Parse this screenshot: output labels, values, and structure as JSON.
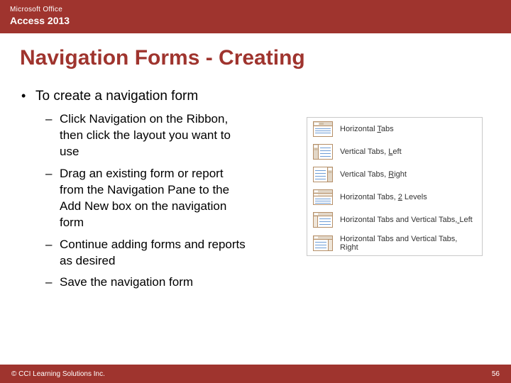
{
  "header": {
    "brand_small": "Microsoft Office",
    "product": "Access 2013"
  },
  "title": "Navigation Forms - Creating",
  "bullets": {
    "main": "To create a navigation form",
    "subs": [
      "Click Navigation on the Ribbon, then click the layout you want to use",
      "Drag an existing form or report from the Navigation Pane to the Add New box on the navigation form",
      "Continue adding forms and reports as desired",
      "Save the navigation form"
    ]
  },
  "nav_options": [
    {
      "label": "Horizontal Tabs",
      "u_index": 11,
      "icon": "htabs"
    },
    {
      "label": "Vertical Tabs, Left",
      "u_index": 15,
      "icon": "vtl"
    },
    {
      "label": "Vertical Tabs, Right",
      "u_index": 15,
      "icon": "vtr"
    },
    {
      "label": "Horizontal Tabs, 2 Levels",
      "u_index": 17,
      "icon": "h2"
    },
    {
      "label": "Horizontal Tabs and Vertical Tabs, Left",
      "u_index": 34,
      "icon": "hvl"
    },
    {
      "label": "Horizontal Tabs and Vertical Tabs, Right",
      "u_index": 34,
      "icon": "hvr"
    }
  ],
  "footer": {
    "copyright": "© CCI Learning Solutions Inc.",
    "page": "56"
  }
}
